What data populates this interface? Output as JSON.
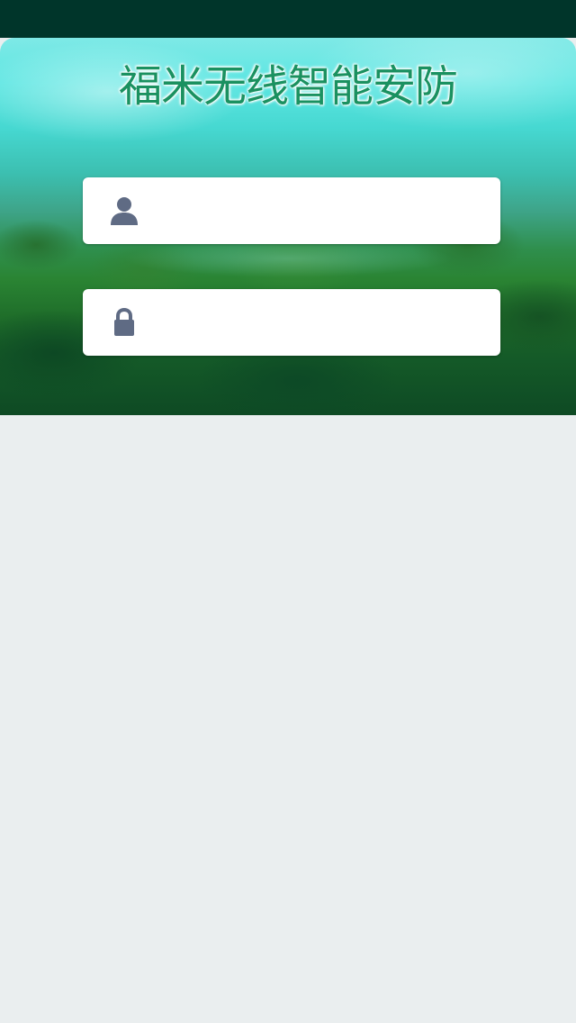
{
  "app": {
    "title": "福米无线智能安防"
  },
  "login": {
    "username": {
      "icon": "user-icon",
      "value": "",
      "placeholder": ""
    },
    "password": {
      "icon": "lock-icon",
      "value": "",
      "placeholder": ""
    }
  },
  "colors": {
    "status_bar": "#00352a",
    "title": "#1a9160",
    "field_background": "#ffffff",
    "icon": "#5f6b84",
    "page_background": "#eaeeef"
  }
}
